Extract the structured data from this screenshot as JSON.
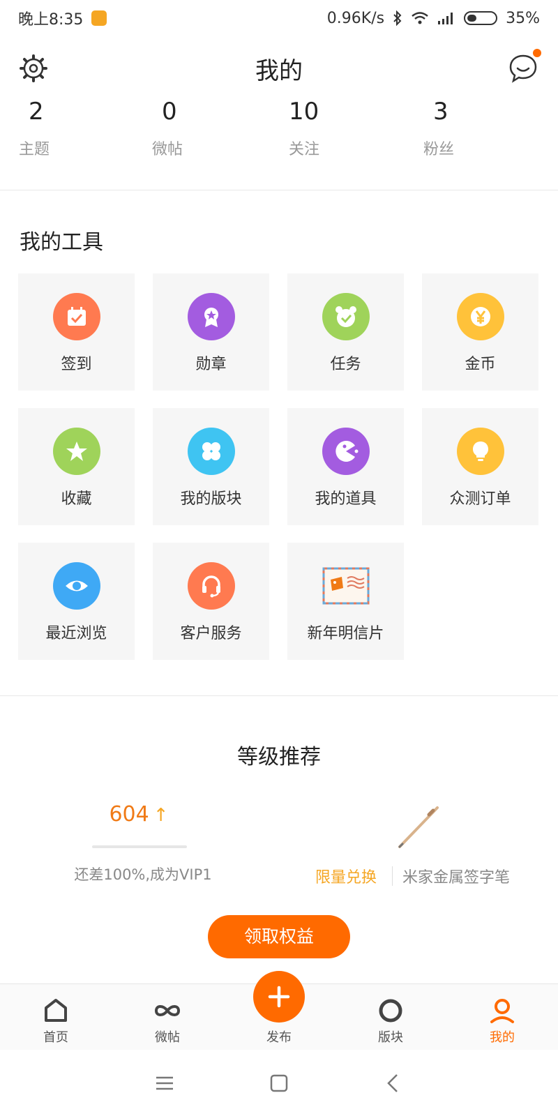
{
  "status_bar": {
    "time": "晚上8:35",
    "net_speed": "0.96K/s",
    "battery": "35%",
    "battery_level": 0.35,
    "icons": [
      "app-notification-icon",
      "bluetooth-icon",
      "wifi-icon",
      "signal-icon",
      "battery-icon"
    ]
  },
  "header": {
    "title": "我的",
    "left_icon": "gear-icon",
    "right_icon": "chat-icon",
    "unread_dot_color": "#ff6a00"
  },
  "stats": [
    {
      "value": "2",
      "label": "主题"
    },
    {
      "value": "0",
      "label": "微帖"
    },
    {
      "value": "10",
      "label": "关注"
    },
    {
      "value": "3",
      "label": "粉丝"
    }
  ],
  "tools": {
    "title": "我的工具",
    "items": [
      {
        "label": "签到",
        "icon": "calendar-check-icon",
        "color": "#ff7a50"
      },
      {
        "label": "勋章",
        "icon": "medal-icon",
        "color": "#a35ce0"
      },
      {
        "label": "任务",
        "icon": "task-check-icon",
        "color": "#9fd35a"
      },
      {
        "label": "金币",
        "icon": "yuan-coin-icon",
        "color": "#ffc23a"
      },
      {
        "label": "收藏",
        "icon": "star-icon",
        "color": "#9fd35a"
      },
      {
        "label": "我的版块",
        "icon": "clover-icon",
        "color": "#3fc4f2"
      },
      {
        "label": "我的道具",
        "icon": "pacman-icon",
        "color": "#a35ce0"
      },
      {
        "label": "众测订单",
        "icon": "lightbulb-icon",
        "color": "#ffc23a"
      },
      {
        "label": "最近浏览",
        "icon": "eye-icon",
        "color": "#3fa9f5"
      },
      {
        "label": "客户服务",
        "icon": "headset-icon",
        "color": "#ff7a50"
      },
      {
        "label": "新年明信片",
        "icon": "postcard-icon",
        "color": "#f07a16"
      }
    ]
  },
  "level": {
    "title": "等级推荐",
    "score": "604",
    "score_arrow": "↑",
    "progress": 0.0,
    "hint": "还差100%,成为VIP1",
    "exchange_label": "限量兑换",
    "product_name": "米家金属签字笔",
    "claim_button": "领取权益"
  },
  "bottom_nav": {
    "items": [
      {
        "label": "首页",
        "icon": "home-icon",
        "active": false
      },
      {
        "label": "微帖",
        "icon": "infinity-icon",
        "active": false
      },
      {
        "label": "发布",
        "icon": "plus-icon",
        "active": false
      },
      {
        "label": "版块",
        "icon": "ring-icon",
        "active": false
      },
      {
        "label": "我的",
        "icon": "user-icon",
        "active": true
      }
    ],
    "accent": "#ff6a00"
  },
  "system_nav": {
    "icons": [
      "menu-icon",
      "home-square-icon",
      "back-icon"
    ]
  }
}
